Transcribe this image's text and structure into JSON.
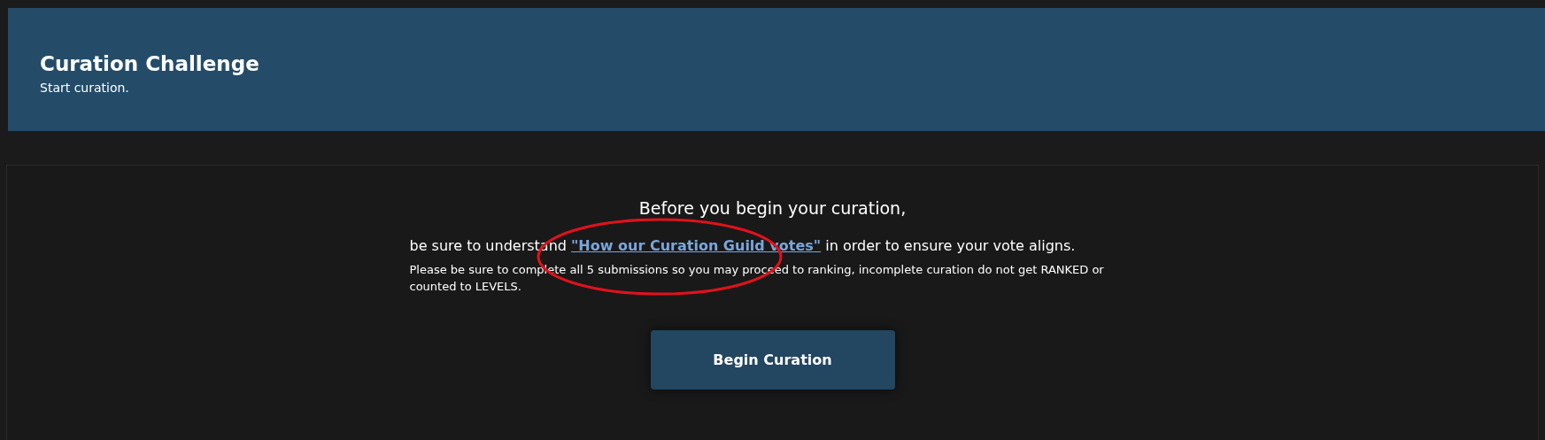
{
  "header": {
    "title": "Curation Challenge",
    "subtitle": "Start curation."
  },
  "intro": {
    "heading": "Before you begin your curation,",
    "before_link": "be sure to understand ",
    "link": "\"How our Curation Guild votes\"",
    "after_link": " in order to ensure your vote aligns.",
    "note": "Please be sure to complete all 5 submissions so you may proceed to ranking, incomplete curation do not get RANKED or counted to LEVELS."
  },
  "annotation": {
    "kind": "ellipse"
  },
  "button": "Begin Curation"
}
